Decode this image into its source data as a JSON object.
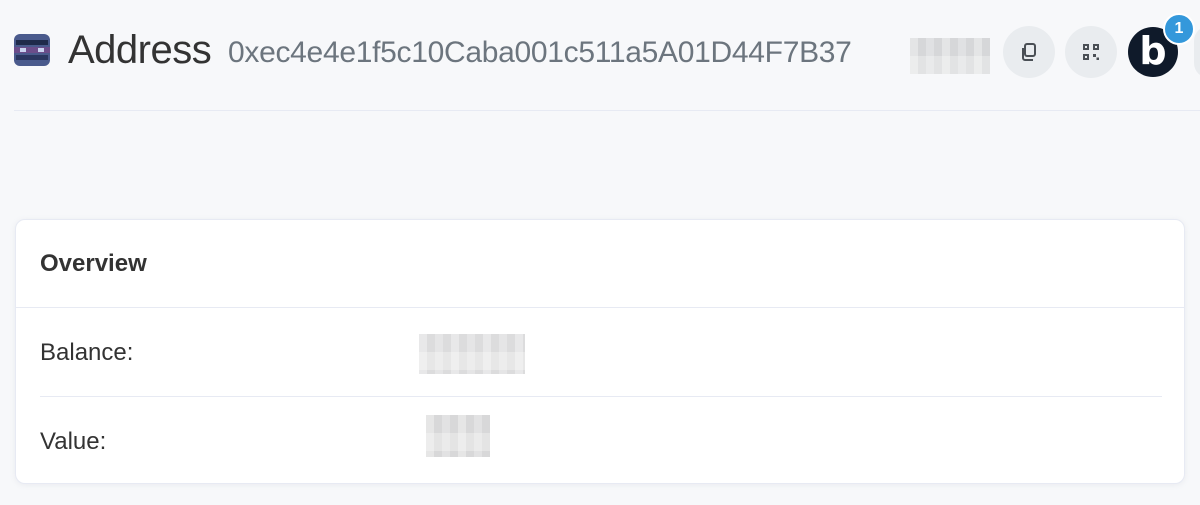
{
  "header": {
    "title": "Address",
    "address": "0xec4e4e1f5c10Caba001c511a5A01D44F7B37",
    "avatar_letter": "b",
    "notification_count": "1"
  },
  "overview": {
    "title": "Overview",
    "rows": [
      {
        "label": "Balance:"
      },
      {
        "label": "Value:"
      }
    ]
  },
  "colors": {
    "accent": "#3498db",
    "avatar_bg": "#0f1a2a",
    "address_icon": "#4a5a8c"
  },
  "icons": {
    "address": "blockie-avatar-icon",
    "copy": "copy-icon",
    "qr": "qr-code-icon"
  }
}
